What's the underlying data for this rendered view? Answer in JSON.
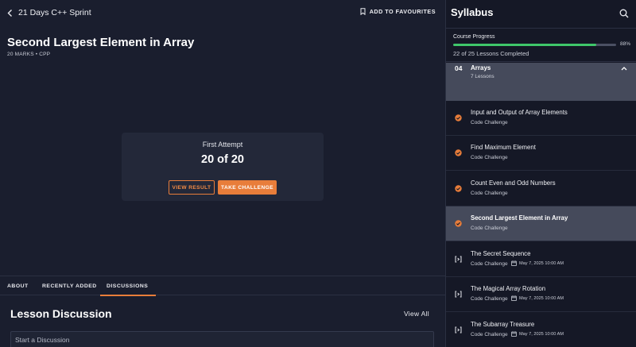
{
  "header": {
    "course_title": "21 Days C++ Sprint",
    "favourite_label": "ADD TO FAVOURITES"
  },
  "lesson": {
    "title": "Second Largest Element in Array",
    "meta": "20 MARKS • CPP"
  },
  "attempt": {
    "label": "First Attempt",
    "score": "20 of 20",
    "view_result": "VIEW RESULT",
    "take_challenge": "TAKE CHALLENGE"
  },
  "tabs": [
    {
      "label": "ABOUT"
    },
    {
      "label": "RECENTLY ADDED"
    },
    {
      "label": "DISCUSSIONS",
      "active": true
    }
  ],
  "discussion": {
    "title": "Lesson Discussion",
    "view_all": "View All",
    "placeholder": "Start a Discussion"
  },
  "sidebar": {
    "title": "Syllabus",
    "progress": {
      "label": "Course Progress",
      "percent_text": "88%",
      "fraction": 0.88,
      "completed_text": "22 of 25 Lessons Completed"
    },
    "module": {
      "number": "04",
      "name": "Arrays",
      "count": "7 Lessons"
    },
    "lessons": [
      {
        "name": "Input and Output of Array Elements",
        "type": "Code Challenge",
        "status": "completed",
        "date": ""
      },
      {
        "name": "Find Maximum Element",
        "type": "Code Challenge",
        "status": "completed",
        "date": ""
      },
      {
        "name": "Count Even and Odd Numbers",
        "type": "Code Challenge",
        "status": "completed",
        "date": ""
      },
      {
        "name": "Second Largest Element in Array",
        "type": "Code Challenge",
        "status": "completed",
        "date": "",
        "selected": true
      },
      {
        "name": "The Secret Sequence",
        "type": "Code Challenge",
        "status": "scheduled",
        "date": "May 7, 2025 10:00 AM"
      },
      {
        "name": "The Magical Array Rotation",
        "type": "Code Challenge",
        "status": "scheduled",
        "date": "May 7, 2025 10:00 AM"
      },
      {
        "name": "The Subarray Treasure",
        "type": "Code Challenge",
        "status": "scheduled",
        "date": "May 7, 2025 10:00 AM"
      }
    ]
  },
  "colors": {
    "accent": "#e87d3a",
    "progress": "#3fc76a",
    "background": "#1a1e2e",
    "sidebar": "#151826"
  }
}
